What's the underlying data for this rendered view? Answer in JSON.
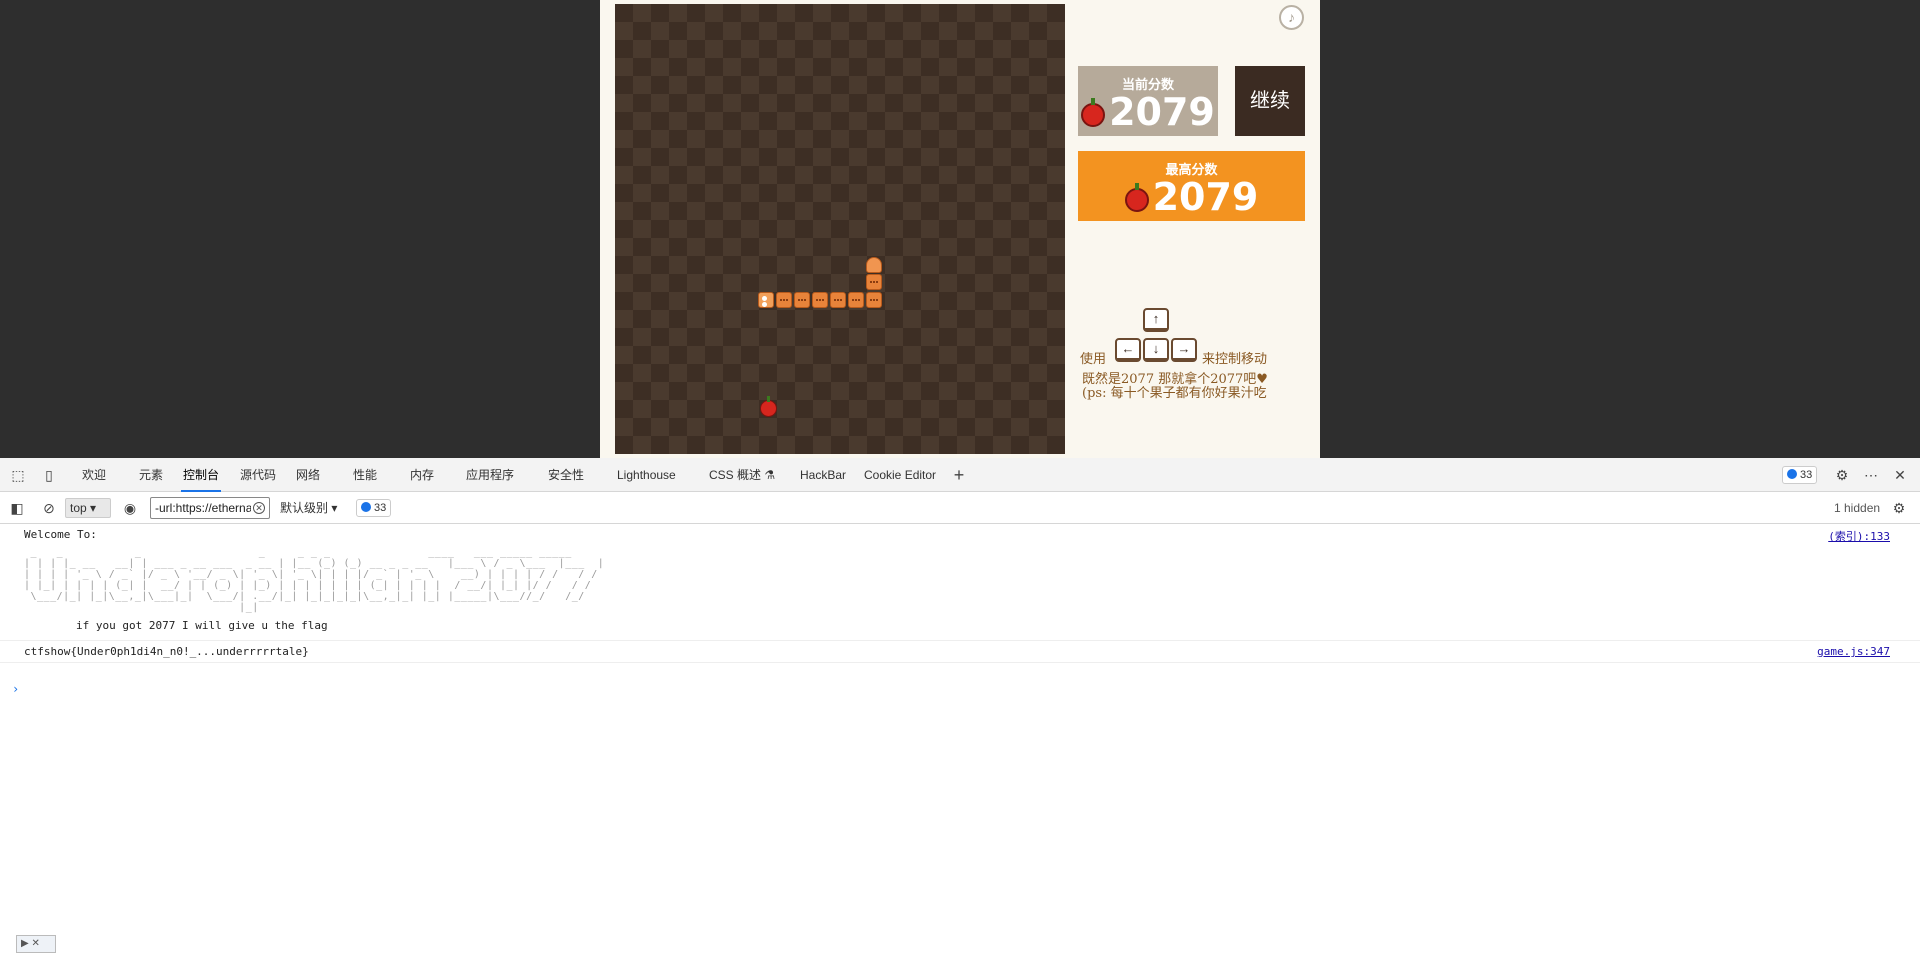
{
  "game": {
    "current_score_label": "当前分数",
    "current_score": "2079",
    "best_score_label": "最高分数",
    "best_score": "2079",
    "continue_label": "继续",
    "music_icon": "♪",
    "controls": {
      "use_label": "使用",
      "move_label": "来控制移动",
      "up_key": "↑",
      "left_key": "←",
      "down_key": "↓",
      "right_key": "→",
      "hint_line1": "既然是2077 那就拿个2077吧♥",
      "hint_line2": "(ps: 每十个果子都有你好果汁吃"
    }
  },
  "devtools": {
    "tabs": [
      "欢迎",
      "元素",
      "控制台",
      "源代码",
      "网络",
      "性能",
      "内存",
      "应用程序",
      "安全性",
      "Lighthouse",
      "CSS 概述 ⚗",
      "HackBar",
      "Cookie Editor"
    ],
    "active_tab": "控制台",
    "add_tab": "+",
    "issues_count": "33",
    "context": "top",
    "filter_value": "-url:https://etherna",
    "level": "默认级别",
    "toolbar_issues": "33",
    "hidden": "1 hidden",
    "console": {
      "welcome": "Welcome To:",
      "welcome_source": "(索引):133",
      "banner": " _   _           _                  _     _ _ _               ____   ___ _____ _____ \n| | | |_ __   __| | ___ _ __ ___  _ __ | |__ (_) (_) __ _ _ __   |___ \\ / _ \\___  |___  |\n| | | | '_ \\ / _` |/ _ \\ '__/ _ \\| '_ \\| '_ \\| | | |/ _` | '_ \\    __) | | | | / /   / / \n| |_| | | | | (_| |  __/ | | (_) | |_) | | | | | | | (_| | | | |  / __/| |_| |/ /   / /  \n \\___/|_| |_|\\__,_|\\___|_|  \\___/| .__/|_| |_|_|_|_|\\__,_|_| |_| |_____|\\___//_/   /_/   \n                                 |_|",
      "flag_hint": "if you got 2077 I will give u the flag",
      "flag": "ctfshow{Under0ph1di4n_n0!_...underrrrrtale}",
      "flag_source": "game.js:347"
    }
  }
}
